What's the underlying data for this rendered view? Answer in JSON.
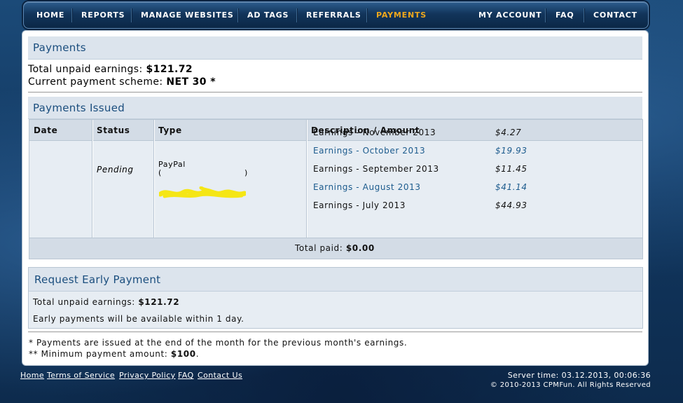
{
  "nav": {
    "left": [
      "HOME",
      "REPORTS",
      "MANAGE WEBSITES",
      "AD TAGS",
      "REFERRALS",
      "PAYMENTS"
    ],
    "right": [
      "MY ACCOUNT",
      "FAQ",
      "CONTACT"
    ],
    "active": "PAYMENTS",
    "active_color": "#f0a81c"
  },
  "payments": {
    "title": "Payments",
    "unpaid_label": "Total unpaid earnings:",
    "unpaid_value": "$121.72",
    "scheme_label": "Current payment scheme:",
    "scheme_value": "NET 30 *"
  },
  "issued": {
    "title": "Payments Issued",
    "columns": [
      "Date",
      "Status",
      "Type",
      "Description / Amount"
    ],
    "row": {
      "date": "",
      "status": "Pending",
      "type_label": "PayPal",
      "type_detail_open": "(",
      "type_detail_close": ")",
      "items": [
        {
          "desc": "Earnings - November 2013",
          "amount": "$4.27",
          "link": false
        },
        {
          "desc": "Earnings - October 2013",
          "amount": "$19.93",
          "link": true
        },
        {
          "desc": "Earnings - September 2013",
          "amount": "$11.45",
          "link": false
        },
        {
          "desc": "Earnings - August 2013",
          "amount": "$41.14",
          "link": true
        },
        {
          "desc": "Earnings - July 2013",
          "amount": "$44.93",
          "link": false
        }
      ]
    },
    "total_label": "Total paid:",
    "total_value": "$0.00"
  },
  "early": {
    "title": "Request Early Payment",
    "unpaid_label": "Total unpaid earnings:",
    "unpaid_value": "$121.72",
    "note": "Early payments will be available within 1 day."
  },
  "notes": {
    "note1": "* Payments are issued at the end of the month for the previous month's earnings.",
    "note2_label": "** Minimum payment amount:",
    "note2_value": "$100",
    "note2_end": "."
  },
  "footer": {
    "links": [
      "Home",
      "Terms of Service",
      "Privacy Policy",
      "FAQ",
      "Contact Us"
    ],
    "server_time": "Server time: 03.12.2013, 00:06:36",
    "copyright": "© 2010-2013 CPMFun. All Rights Reserved"
  }
}
